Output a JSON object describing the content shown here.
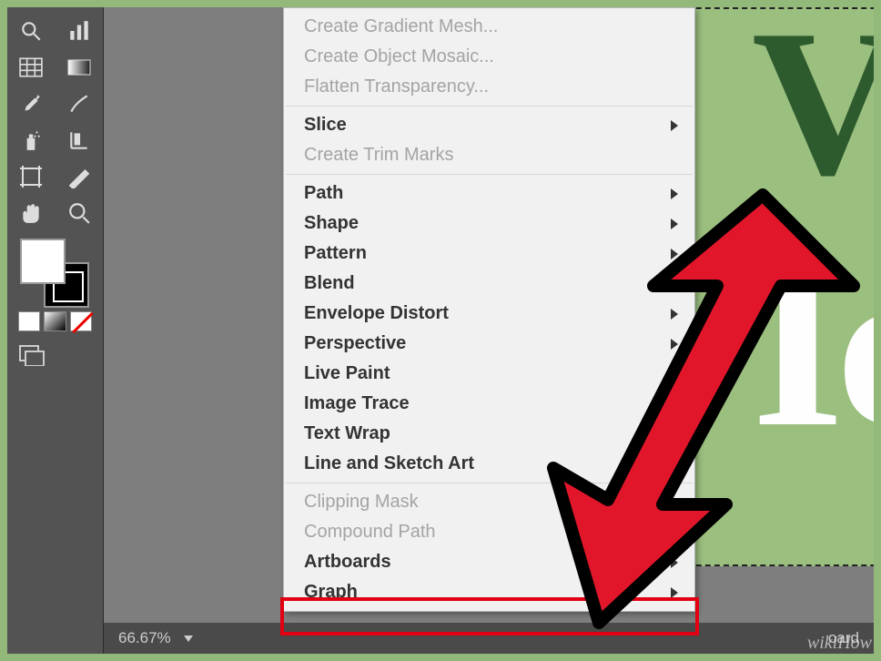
{
  "menu": {
    "items": [
      {
        "label": "Create Gradient Mesh...",
        "disabled": true,
        "submenu": false,
        "bold": false
      },
      {
        "label": "Create Object Mosaic...",
        "disabled": true,
        "submenu": false,
        "bold": false
      },
      {
        "label": "Flatten Transparency...",
        "disabled": true,
        "submenu": false,
        "bold": false
      },
      {
        "sep": true
      },
      {
        "label": "Slice",
        "disabled": false,
        "submenu": true,
        "bold": true
      },
      {
        "label": "Create Trim Marks",
        "disabled": true,
        "submenu": false,
        "bold": false
      },
      {
        "sep": true
      },
      {
        "label": "Path",
        "disabled": false,
        "submenu": true,
        "bold": true
      },
      {
        "label": "Shape",
        "disabled": false,
        "submenu": true,
        "bold": true
      },
      {
        "label": "Pattern",
        "disabled": false,
        "submenu": true,
        "bold": true
      },
      {
        "label": "Blend",
        "disabled": false,
        "submenu": true,
        "bold": true
      },
      {
        "label": "Envelope Distort",
        "disabled": false,
        "submenu": true,
        "bold": true
      },
      {
        "label": "Perspective",
        "disabled": false,
        "submenu": true,
        "bold": true
      },
      {
        "label": "Live Paint",
        "disabled": false,
        "submenu": true,
        "bold": true
      },
      {
        "label": "Image Trace",
        "disabled": false,
        "submenu": true,
        "bold": true
      },
      {
        "label": "Text Wrap",
        "disabled": false,
        "submenu": true,
        "bold": true
      },
      {
        "label": "Line and Sketch Art",
        "disabled": false,
        "submenu": true,
        "bold": true
      },
      {
        "sep": true
      },
      {
        "label": "Clipping Mask",
        "disabled": true,
        "submenu": true,
        "bold": false
      },
      {
        "label": "Compound Path",
        "disabled": true,
        "submenu": true,
        "bold": false
      },
      {
        "label": "Artboards",
        "disabled": false,
        "submenu": true,
        "bold": true
      },
      {
        "label": "Graph",
        "disabled": false,
        "submenu": true,
        "bold": true
      }
    ]
  },
  "status": {
    "zoom": "66.67%",
    "extra": "oard"
  },
  "canvas": {
    "line1": "VI",
    "line2": "Ic"
  },
  "watermark": "wikiHow",
  "tools": {
    "row1": [
      "magnify",
      "column-graph"
    ],
    "row2": [
      "mesh",
      "gradient"
    ],
    "row3": [
      "eyedropper",
      "knife"
    ],
    "row4": [
      "spray",
      "bar-tool"
    ],
    "row5": [
      "artboard",
      "slice"
    ],
    "row6": [
      "hand",
      "zoom"
    ]
  }
}
